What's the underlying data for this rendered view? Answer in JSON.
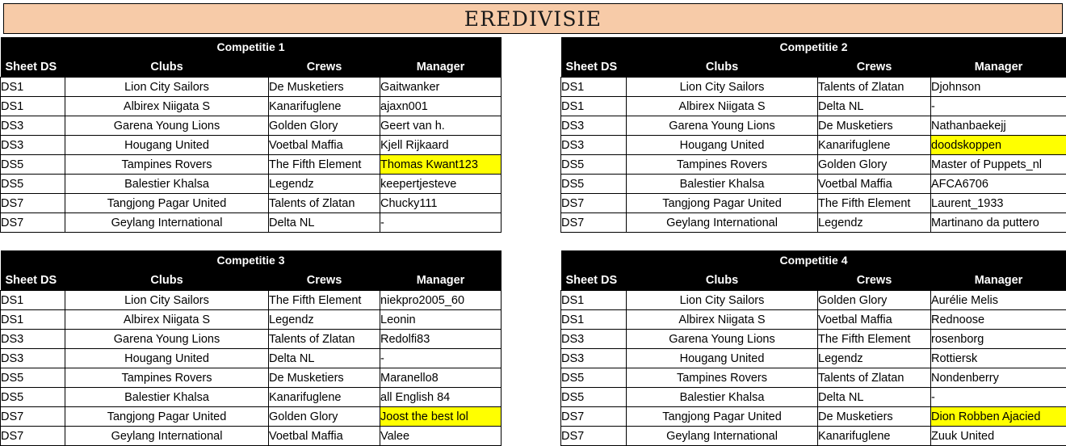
{
  "page": {
    "title": "EREDIVISIE",
    "banner_color": "#F7CBA8",
    "header_color": "#000000",
    "highlight_color": "#FFFF00"
  },
  "columns": {
    "sheet": "Sheet DS",
    "clubs": "Clubs",
    "crews": "Crews",
    "manager": "Manager"
  },
  "competitions": [
    {
      "title": "Competitie 1",
      "rows": [
        {
          "sheet": "DS1",
          "club": "Lion City Sailors",
          "crew": "De Musketiers",
          "manager": "Gaitwanker",
          "highlight": false
        },
        {
          "sheet": "DS1",
          "club": "Albirex Niigata S",
          "crew": "Kanarifuglene",
          "manager": "ajaxn001",
          "highlight": false
        },
        {
          "sheet": "DS3",
          "club": "Garena Young Lions",
          "crew": "Golden Glory",
          "manager": "Geert van h.",
          "highlight": false
        },
        {
          "sheet": "DS3",
          "club": "Hougang United",
          "crew": "Voetbal Maffia",
          "manager": "Kjell Rijkaard",
          "highlight": false
        },
        {
          "sheet": "DS5",
          "club": "Tampines Rovers",
          "crew": "The Fifth Element",
          "manager": "Thomas Kwant123",
          "highlight": true
        },
        {
          "sheet": "DS5",
          "club": "Balestier Khalsa",
          "crew": "Legendz",
          "manager": "keepertjesteve",
          "highlight": false
        },
        {
          "sheet": "DS7",
          "club": "Tangjong Pagar United",
          "crew": "Talents of Zlatan",
          "manager": "Chucky111",
          "highlight": false
        },
        {
          "sheet": "DS7",
          "club": "Geylang International",
          "crew": "Delta NL",
          "manager": "-",
          "highlight": false
        }
      ]
    },
    {
      "title": "Competitie 2",
      "rows": [
        {
          "sheet": "DS1",
          "club": "Lion City Sailors",
          "crew": "Talents of Zlatan",
          "manager": "Djohnson",
          "highlight": false
        },
        {
          "sheet": "DS1",
          "club": "Albirex Niigata S",
          "crew": "Delta NL",
          "manager": "-",
          "highlight": false
        },
        {
          "sheet": "DS3",
          "club": "Garena Young Lions",
          "crew": "De Musketiers",
          "manager": "Nathanbaekejj",
          "highlight": false
        },
        {
          "sheet": "DS3",
          "club": "Hougang United",
          "crew": "Kanarifuglene",
          "manager": "doodskoppen",
          "highlight": true
        },
        {
          "sheet": "DS5",
          "club": "Tampines Rovers",
          "crew": "Golden Glory",
          "manager": "Master of Puppets_nl",
          "highlight": false
        },
        {
          "sheet": "DS5",
          "club": "Balestier Khalsa",
          "crew": "Voetbal Maffia",
          "manager": "AFCA6706",
          "highlight": false
        },
        {
          "sheet": "DS7",
          "club": "Tangjong Pagar United",
          "crew": "The Fifth Element",
          "manager": "Laurent_1933",
          "highlight": false
        },
        {
          "sheet": "DS7",
          "club": "Geylang International",
          "crew": "Legendz",
          "manager": "Martinano da puttero",
          "highlight": false
        }
      ]
    },
    {
      "title": "Competitie 3",
      "rows": [
        {
          "sheet": "DS1",
          "club": "Lion City Sailors",
          "crew": "The Fifth Element",
          "manager": "niekpro2005_60",
          "highlight": false
        },
        {
          "sheet": "DS1",
          "club": "Albirex Niigata S",
          "crew": "Legendz",
          "manager": "Leonin",
          "highlight": false
        },
        {
          "sheet": "DS3",
          "club": "Garena Young Lions",
          "crew": "Talents of Zlatan",
          "manager": "Redolfi83",
          "highlight": false
        },
        {
          "sheet": "DS3",
          "club": "Hougang United",
          "crew": "Delta NL",
          "manager": "-",
          "highlight": false
        },
        {
          "sheet": "DS5",
          "club": "Tampines Rovers",
          "crew": "De Musketiers",
          "manager": "Maranello8",
          "highlight": false
        },
        {
          "sheet": "DS5",
          "club": "Balestier Khalsa",
          "crew": "Kanarifuglene",
          "manager": "all English 84",
          "highlight": false
        },
        {
          "sheet": "DS7",
          "club": "Tangjong Pagar United",
          "crew": "Golden Glory",
          "manager": "Joost the best lol",
          "highlight": true
        },
        {
          "sheet": "DS7",
          "club": "Geylang International",
          "crew": "Voetbal Maffia",
          "manager": "Valee",
          "highlight": false
        }
      ]
    },
    {
      "title": "Competitie 4",
      "rows": [
        {
          "sheet": "DS1",
          "club": "Lion City Sailors",
          "crew": "Golden Glory",
          "manager": "Aurélie Melis",
          "highlight": false
        },
        {
          "sheet": "DS1",
          "club": "Albirex Niigata S",
          "crew": "Voetbal Maffia",
          "manager": "Rednoose",
          "highlight": false
        },
        {
          "sheet": "DS3",
          "club": "Garena Young Lions",
          "crew": "The Fifth Element",
          "manager": "rosenborg",
          "highlight": false
        },
        {
          "sheet": "DS3",
          "club": "Hougang United",
          "crew": "Legendz",
          "manager": "Rottiersk",
          "highlight": false
        },
        {
          "sheet": "DS5",
          "club": "Tampines Rovers",
          "crew": "Talents of Zlatan",
          "manager": "Nondenberry",
          "highlight": false
        },
        {
          "sheet": "DS5",
          "club": "Balestier Khalsa",
          "crew": "Delta NL",
          "manager": "-",
          "highlight": false
        },
        {
          "sheet": "DS7",
          "club": "Tangjong Pagar United",
          "crew": "De Musketiers",
          "manager": "Dion Robben Ajacied",
          "highlight": true
        },
        {
          "sheet": "DS7",
          "club": "Geylang International",
          "crew": "Kanarifuglene",
          "manager": "Zuuk United",
          "highlight": false
        }
      ]
    }
  ]
}
